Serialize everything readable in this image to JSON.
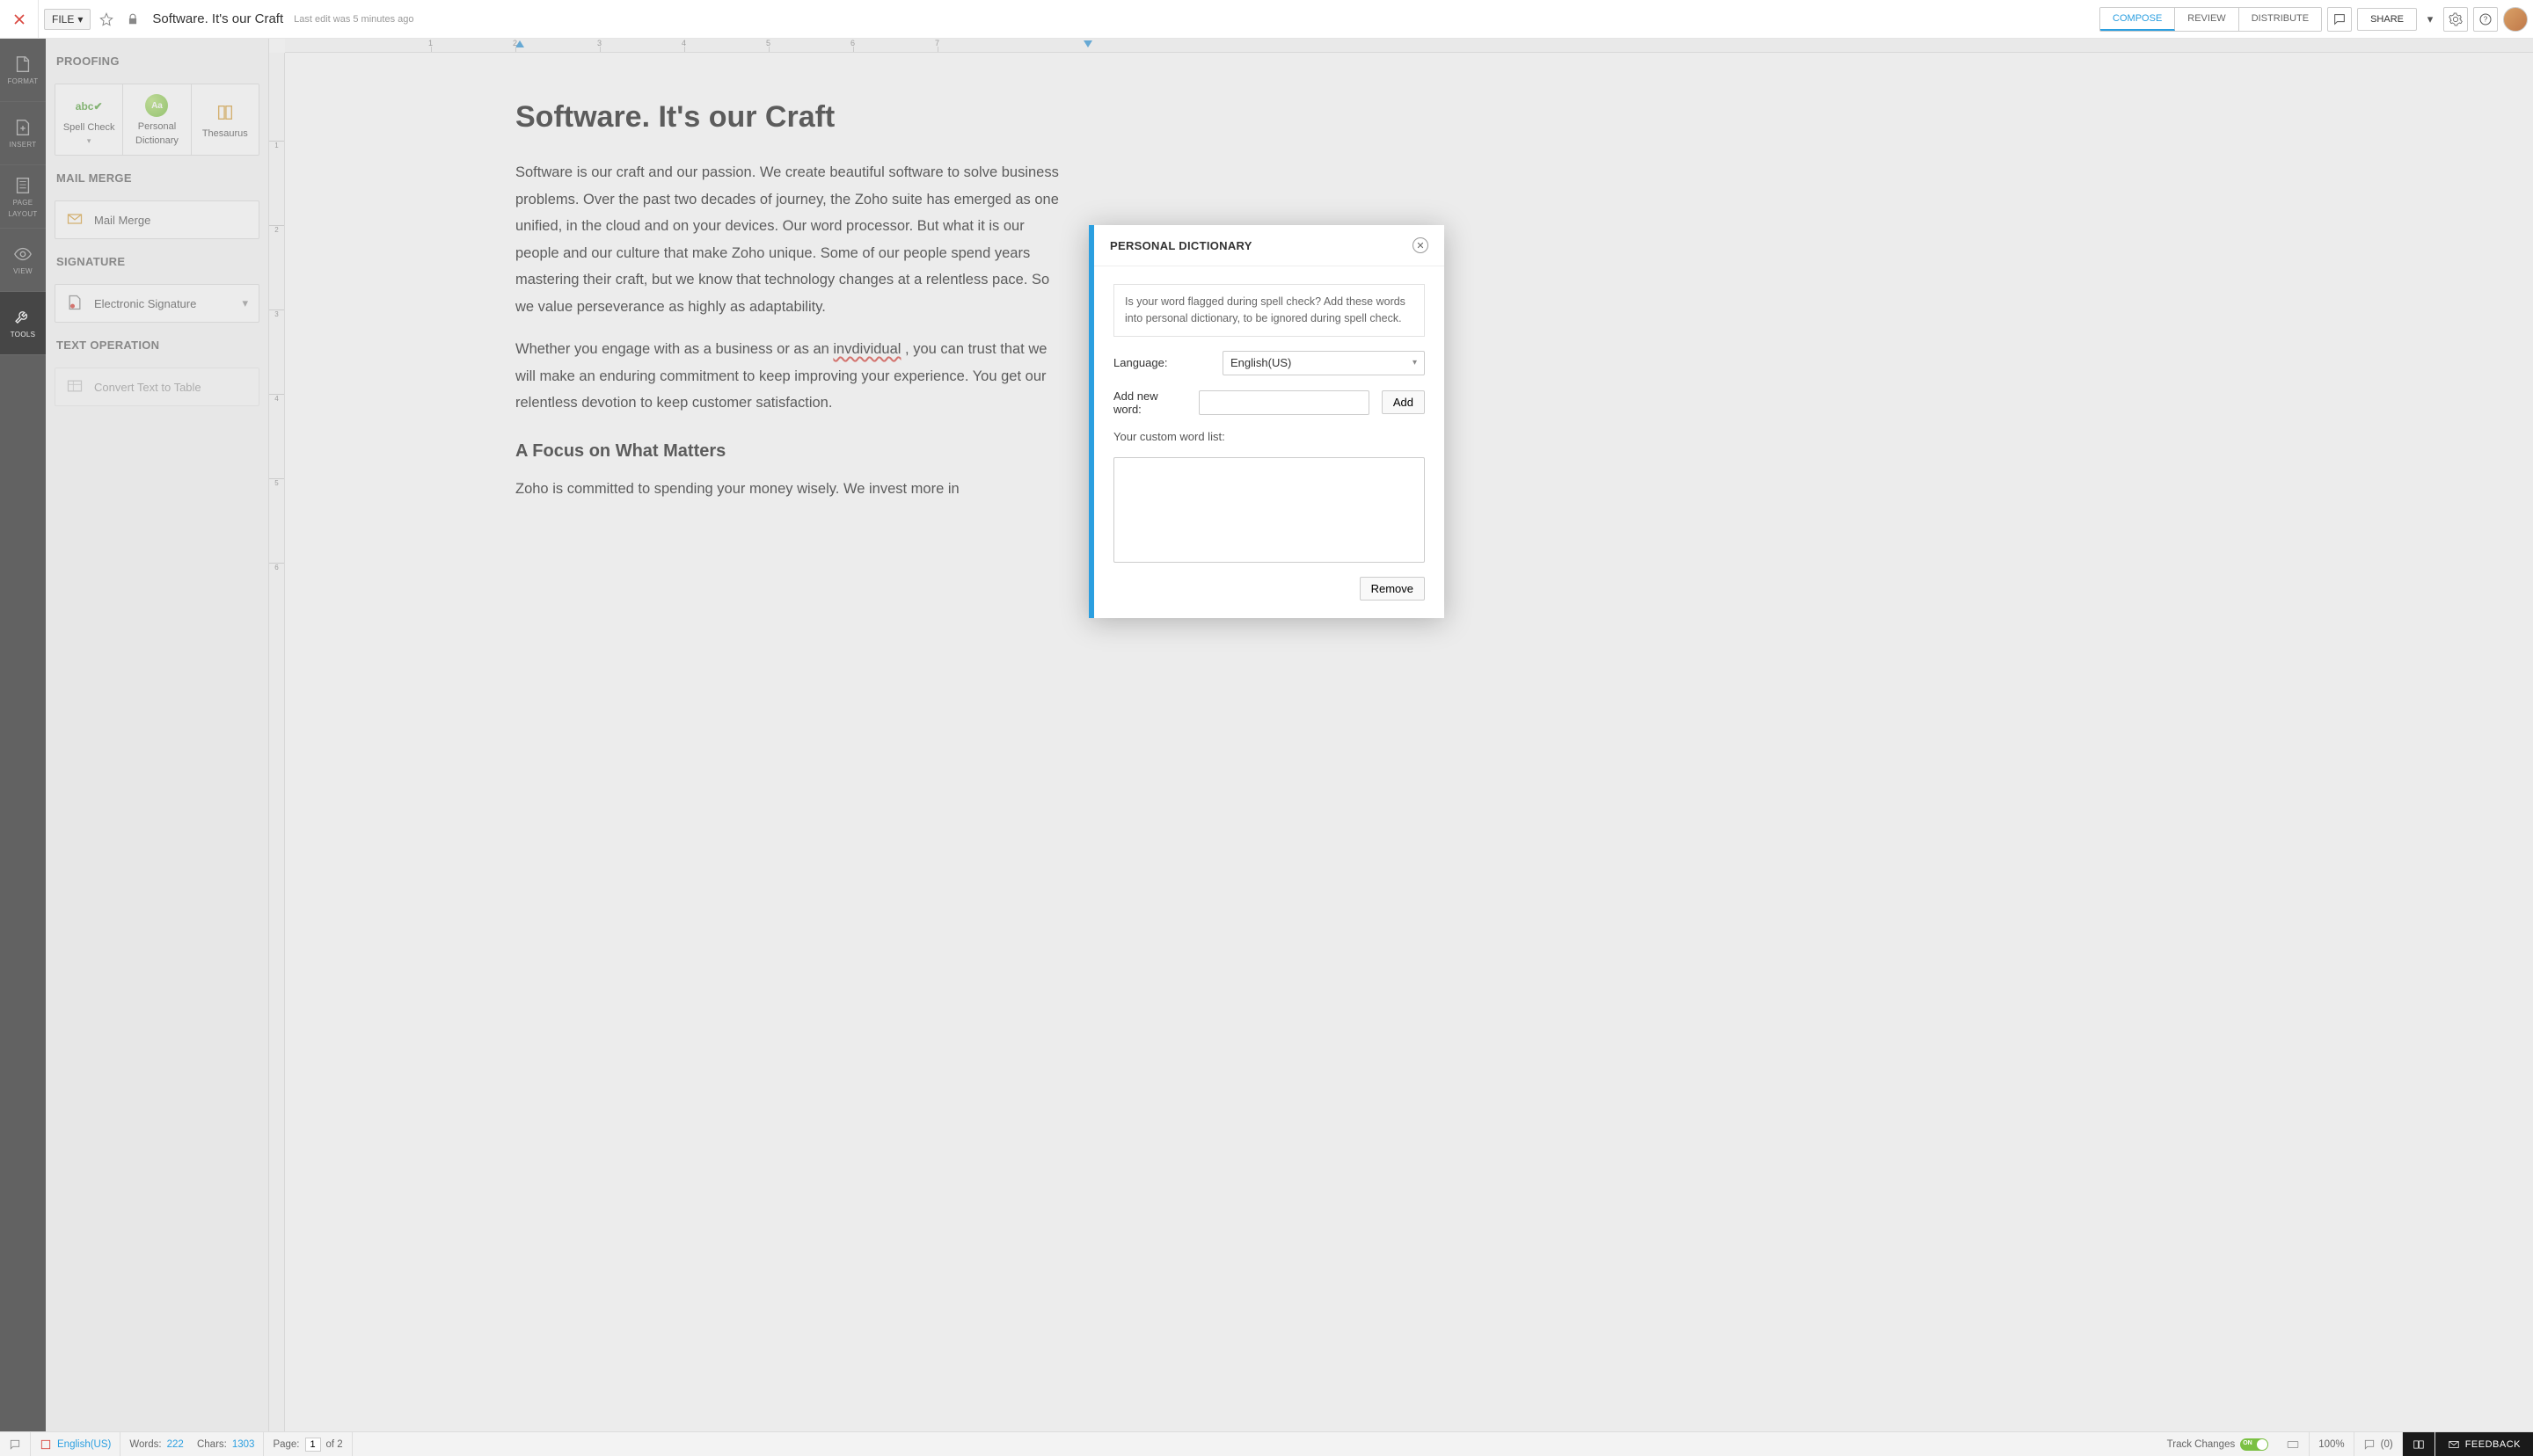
{
  "header": {
    "file_menu": "FILE",
    "doc_title": "Software. It's our Craft",
    "last_edit": "Last edit was 5 minutes ago",
    "tabs": {
      "compose": "COMPOSE",
      "review": "REVIEW",
      "distribute": "DISTRIBUTE"
    },
    "share": "SHARE"
  },
  "rail": {
    "format": "FORMAT",
    "insert": "INSERT",
    "page_layout_l1": "PAGE",
    "page_layout_l2": "LAYOUT",
    "view": "VIEW",
    "tools": "TOOLS"
  },
  "sidepanel": {
    "proofing": {
      "title": "PROOFING",
      "spell_check": "Spell Check",
      "personal_dict_l1": "Personal",
      "personal_dict_l2": "Dictionary",
      "thesaurus": "Thesaurus"
    },
    "mail_merge": {
      "title": "MAIL MERGE",
      "item": "Mail Merge"
    },
    "signature": {
      "title": "SIGNATURE",
      "item": "Electronic Signature"
    },
    "text_op": {
      "title": "TEXT OPERATION",
      "item": "Convert Text to Table"
    }
  },
  "ruler": {
    "h": [
      "1",
      "2",
      "3",
      "4",
      "5",
      "6",
      "7"
    ],
    "v": [
      "1",
      "2",
      "3",
      "4",
      "5",
      "6"
    ]
  },
  "document": {
    "h1": "Software. It's our Craft",
    "p1a": "Software is our craft and our passion. We create beautiful software to solve business problems. Over the past two decades of  journey, the Zoho suite has emerged as one unified, in the cloud and on your devices. Our word processor. But what it is our people and our culture that make Zoho unique. Some of our people spend years mastering their craft, but we know that technology changes at a relentless pace. So we value perseverance as highly as adaptability.",
    "p2a": "Whether you engage with  as a business or as an ",
    "p2err": "invdividual",
    "p2b": ", you can trust that we will make an enduring commitment to keep improving your experience.  You get our relentless devotion to keep customer satisfaction.",
    "h2": "A Focus on What Matters",
    "p3": "Zoho is committed to spending your money wisely. We invest more in"
  },
  "modal": {
    "title": "PERSONAL DICTIONARY",
    "info": "Is your word flagged during spell check? Add these words into personal dictionary, to be ignored during spell check.",
    "language_label": "Language:",
    "language_value": "English(US)",
    "add_word_label": "Add new word:",
    "add_btn": "Add",
    "list_label": "Your custom word list:",
    "remove_btn": "Remove"
  },
  "status": {
    "language": "English(US)",
    "words_label": "Words:",
    "words": "222",
    "chars_label": "Chars:",
    "chars": "1303",
    "page_label": "Page:",
    "page_current": "1",
    "page_of": "of 2",
    "track_changes": "Track Changes",
    "track_on": "ON",
    "zoom": "100%",
    "comments_count": "(0)",
    "feedback": "FEEDBACK"
  }
}
